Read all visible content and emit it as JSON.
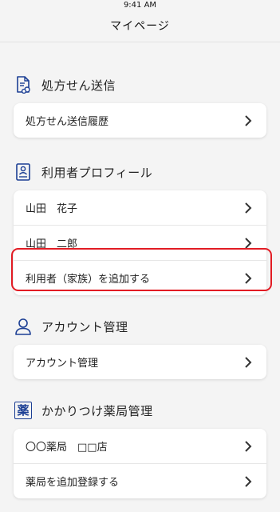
{
  "status_bar": {
    "time": "9:41 AM"
  },
  "header": {
    "title": "マイページ"
  },
  "sections": [
    {
      "id": "prescription",
      "title": "処方せん送信",
      "icon": "prescription-document-icon",
      "rows": [
        {
          "label": "処方せん送信履歴"
        }
      ]
    },
    {
      "id": "profile",
      "title": "利用者プロフィール",
      "icon": "user-profile-card-icon",
      "rows": [
        {
          "label": "山田　花子"
        },
        {
          "label": "山田　二郎"
        },
        {
          "label": "利用者（家族）を追加する",
          "highlighted": true
        }
      ]
    },
    {
      "id": "account",
      "title": "アカウント管理",
      "icon": "person-icon",
      "rows": [
        {
          "label": "アカウント管理"
        }
      ]
    },
    {
      "id": "pharmacy",
      "title": "かかりつけ薬局管理",
      "icon": "pharmacy-kanji-icon",
      "icon_text": "薬",
      "rows": [
        {
          "label": "〇〇薬局　□□店"
        },
        {
          "label": "薬局を追加登録する"
        }
      ]
    }
  ],
  "colors": {
    "highlight": "#e21c24",
    "icon_blue": "#1c3f94"
  }
}
